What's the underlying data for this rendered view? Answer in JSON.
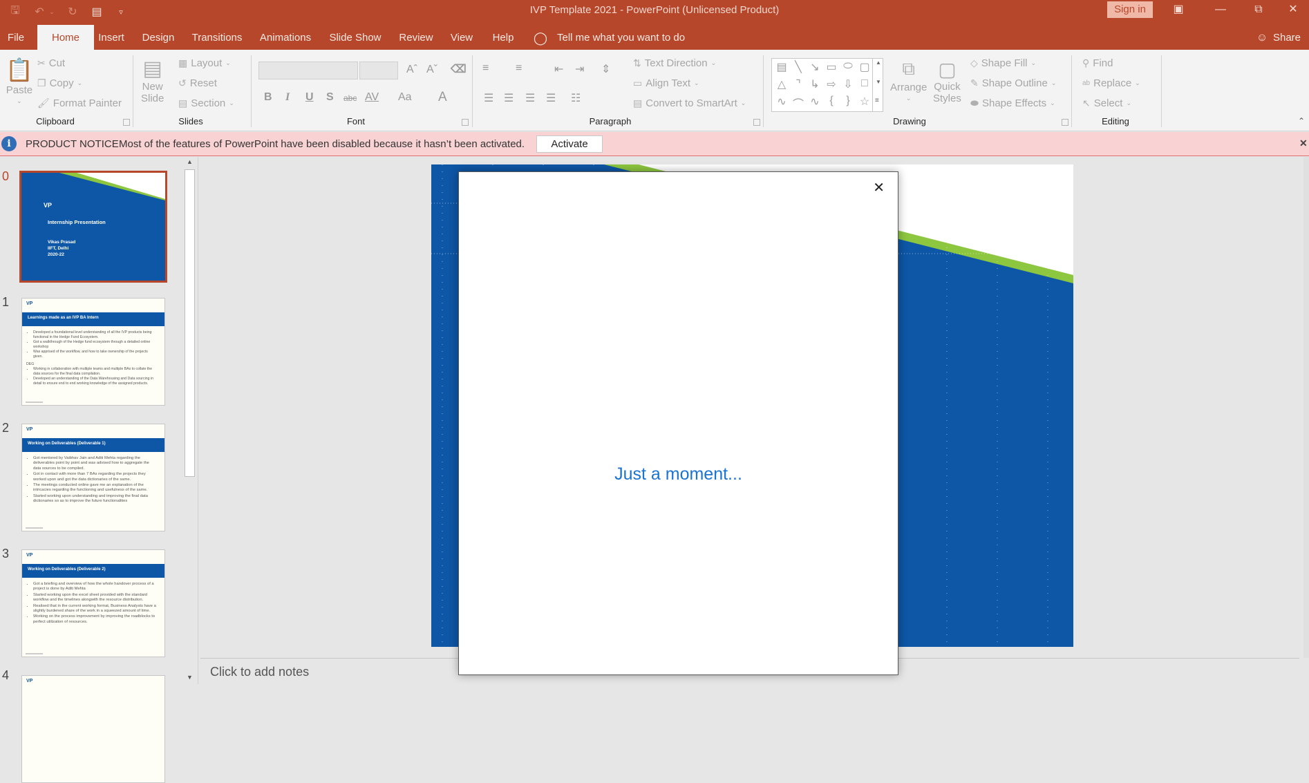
{
  "window": {
    "title": "IVP Template 2021  -  PowerPoint (Unlicensed Product)",
    "sign_in": "Sign in",
    "quick_access": [
      "save-icon",
      "undo-icon",
      "redo-icon",
      "start-slideshow-icon",
      "customize-icon"
    ]
  },
  "tabs": {
    "items": [
      "File",
      "Home",
      "Insert",
      "Design",
      "Transitions",
      "Animations",
      "Slide Show",
      "Review",
      "View",
      "Help"
    ],
    "active": "Home",
    "tell_me": "Tell me what you want to do",
    "share": "Share"
  },
  "ribbon": {
    "clipboard": {
      "label": "Clipboard",
      "paste": "Paste",
      "cut": "Cut",
      "copy": "Copy",
      "format_painter": "Format Painter"
    },
    "slides": {
      "label": "Slides",
      "new_slide_1": "New",
      "new_slide_2": "Slide",
      "layout": "Layout",
      "reset": "Reset",
      "section": "Section"
    },
    "font": {
      "label": "Font",
      "font_name": "",
      "font_size": "",
      "bold": "B",
      "italic": "I",
      "underline": "U",
      "shadow": "S",
      "strikethrough": "abc",
      "spacing": "AV",
      "change_case": "Aa",
      "font_color": "A",
      "grow": "Aˆ",
      "shrink": "Aˇ"
    },
    "paragraph": {
      "label": "Paragraph",
      "text_direction": "Text Direction",
      "align_text": "Align Text",
      "convert_smartart": "Convert to SmartArt"
    },
    "drawing": {
      "label": "Drawing",
      "arrange": "Arrange",
      "quick_styles_1": "Quick",
      "quick_styles_2": "Styles",
      "shape_fill": "Shape Fill",
      "shape_outline": "Shape Outline",
      "shape_effects": "Shape Effects"
    },
    "editing": {
      "label": "Editing",
      "find": "Find",
      "replace": "Replace",
      "select": "Select"
    }
  },
  "notice": {
    "title": "PRODUCT NOTICE",
    "message": "Most of the features of PowerPoint have been disabled because it hasn’t been activated.",
    "button": "Activate"
  },
  "thumbnails": [
    {
      "number": "0",
      "selected": true,
      "title": "Internship Presentation",
      "lines": [
        "Vikas Prasad",
        "IIFT, Delhi",
        "2020-22"
      ]
    },
    {
      "number": "1",
      "title": "Learnings made as an IVP BA Intern",
      "bullets": [
        "Developed a foundational level understanding of all the IVP products being functional in the Hedge Fund Ecosystem.",
        "Got a walkthrough of the Hedge fund ecosystem through a detailed online workshop",
        "Was apprised of the workflow, and how to take ownership of the projects given.",
        "DEG",
        "Working in collaboration with multiple teams and multiple BAs to collate the data sources for the final data compilation.",
        "Developed an understanding of the Data Warehousing and Data sourcing in detail to ensure end to end working knowledge of the assigned products."
      ]
    },
    {
      "number": "2",
      "title": "Working on Deliverables (Deliverable 1)",
      "bullets": [
        "Got mentored by Vaibhav Jain and Aditi Mehta regarding the deliverables point by point and was advised how to aggregate the data sources to be compiled.",
        "Got in contact with more than 7 BAs regarding the projects they worked upon and got the data dictionaries of the same.",
        "The meetings conducted online gave me an explanation of the intricacies regarding the functioning and usefulness of the same.",
        "Started working upon understanding and improving the final data dictionaries so as to improve the future functionalities"
      ]
    },
    {
      "number": "3",
      "title": "Working on Deliverables (Deliverable 2)",
      "bullets": [
        "Got a briefing and overview of how the whole handover process of a project is done by Aditi Mehta",
        "Started working upon the excel sheet provided with the standard workflow and the timelines alongwith the resource distribution.",
        "Realised that in the current working format, Business Analysts have a slightly burdened share of the work in a squeezed amount of time.",
        "Working on the process improvement by improving the roadblocks to perfect utilization of resources."
      ]
    },
    {
      "number": "4"
    }
  ],
  "editor": {
    "notes_placeholder": "Click to add notes"
  },
  "dialog": {
    "message": "Just a moment...",
    "close": "✕"
  },
  "colors": {
    "accent": "#b7472a",
    "slide_blue": "#0e56a6",
    "slide_green": "#8dc63f",
    "dialog_text": "#1b73d3",
    "notice_bg": "#f9d3d3"
  }
}
